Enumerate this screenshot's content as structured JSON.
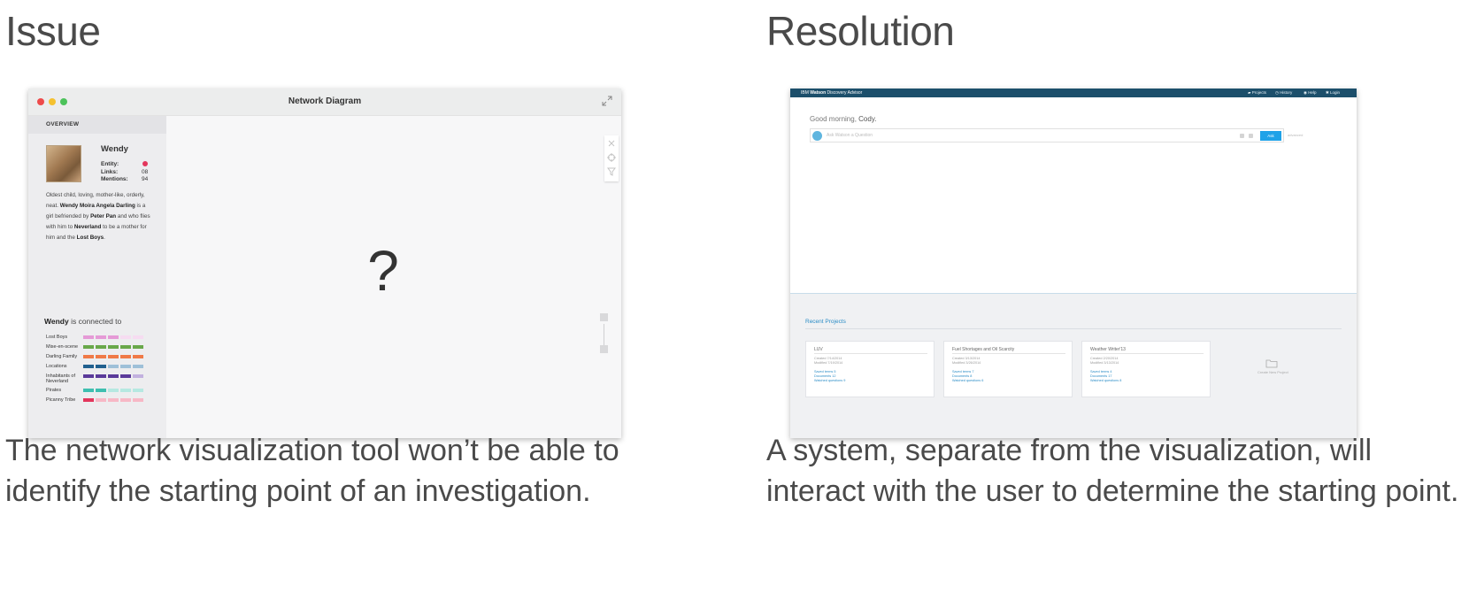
{
  "left": {
    "heading": "Issue",
    "caption": "The network visualization tool won’t be able to identify the starting point of an investigation.",
    "window": {
      "title": "Network Diagram",
      "overview_label": "OVERVIEW",
      "profile": {
        "name": "Wendy",
        "entity_label": "Entity:",
        "entity_color": "#e3365c",
        "links_label": "Links:",
        "links_value": "08",
        "mentions_label": "Mentions:",
        "mentions_value": "94",
        "bio": {
          "t1": "Oldest child, loving, mother-like, orderly, neat.",
          "b1": "Wendy Moira Angela Darling",
          "t2": "is a girl befriended by",
          "b2": "Peter Pan",
          "t3": "and who flies with him to",
          "b3": "Neverland",
          "t4": "to be a mother for him and the",
          "b4": "Lost Boys",
          "t5": "."
        }
      },
      "connected": {
        "name": "Wendy",
        "suffix": " is connected to",
        "groups": [
          {
            "label": "Lost Boys",
            "color": "#e59ad6",
            "light": "#f6dcf1",
            "filled": 3
          },
          {
            "label": "Mise-en-scene",
            "color": "#69a84a",
            "light": "#bfe0ac",
            "filled": 5
          },
          {
            "label": "Darling Family",
            "color": "#f07a47",
            "light": "#fbcdb7",
            "filled": 5
          },
          {
            "label": "Locations",
            "color": "#21608f",
            "light": "#9ec0d8",
            "filled": 2
          },
          {
            "label": "Inhabitants of Neverland",
            "color": "#5a3a9a",
            "light": "#c2b1df",
            "filled": 4
          },
          {
            "label": "Pirates",
            "color": "#3fbfb0",
            "light": "#b6e8e1",
            "filled": 2
          },
          {
            "label": "Picanny Tribe",
            "color": "#e3365c",
            "light": "#f7b8c6",
            "filled": 1
          }
        ]
      },
      "canvas_symbol": "?"
    }
  },
  "right": {
    "heading": "Resolution",
    "caption": "A system, separate from the visualization, will interact with the user to determine the starting point.",
    "app": {
      "brand_ibm": "IBM",
      "brand_watson": "Watson",
      "brand_rest": "Discovery Advisor",
      "nav": [
        "Projects",
        "History",
        "Help",
        "Login"
      ],
      "greeting_prefix": "Good morning,",
      "greeting_name": "Cody.",
      "ask_placeholder": "Ask Watson a Question",
      "ask_button": "Ask",
      "ask_extra": "advanced",
      "recent_title": "Recent Projects",
      "create_label": "Create New Project",
      "projects": [
        {
          "title": "LUV",
          "created": "Created 7/14/2014",
          "modified": "Modified 7/19/2014",
          "saved": "Saved terms 5",
          "docs": "Documents 12",
          "watched": "Watched questions 9"
        },
        {
          "title": "Fuel Shortages and Oil Scarcity",
          "created": "Created 3/13/2014",
          "modified": "Modified 3/26/2014",
          "saved": "Saved terms 7",
          "docs": "Documents 8",
          "watched": "Watched questions 6"
        },
        {
          "title": "Weather Writer'13",
          "created": "Created 2/20/2014",
          "modified": "Modified 3/13/2014",
          "saved": "Saved terms 4",
          "docs": "Documents 17",
          "watched": "Watched questions 8"
        }
      ]
    }
  }
}
